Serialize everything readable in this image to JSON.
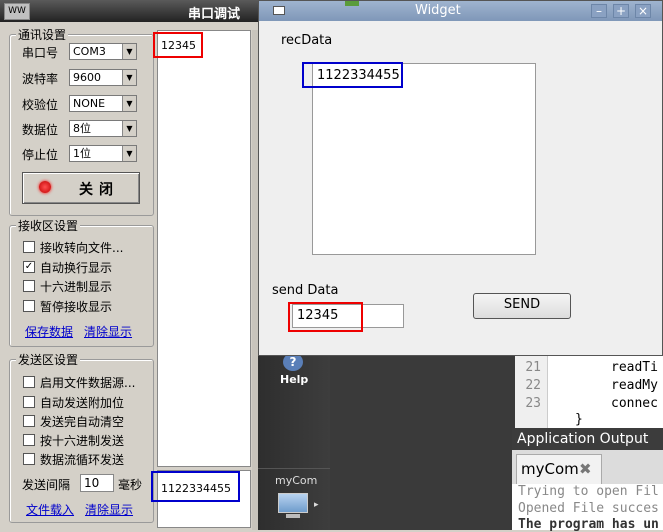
{
  "left_window": {
    "title": "串口调试",
    "app_icon_text": "WW",
    "comm_settings": {
      "title": "通讯设置",
      "rows": [
        {
          "label": "串口号",
          "value": "COM3"
        },
        {
          "label": "波特率",
          "value": "9600"
        },
        {
          "label": "校验位",
          "value": "NONE"
        },
        {
          "label": "数据位",
          "value": "8位"
        },
        {
          "label": "停止位",
          "value": "1位"
        }
      ],
      "close_button": "关闭"
    },
    "receive_settings": {
      "title": "接收区设置",
      "options": [
        {
          "label": "接收转向文件...",
          "checked": false
        },
        {
          "label": "自动换行显示",
          "checked": true
        },
        {
          "label": "十六进制显示",
          "checked": false
        },
        {
          "label": "暂停接收显示",
          "checked": false
        }
      ],
      "save_link": "保存数据",
      "clear_link": "清除显示"
    },
    "send_settings": {
      "title": "发送区设置",
      "options": [
        {
          "label": "启用文件数据源...",
          "checked": false
        },
        {
          "label": "自动发送附加位",
          "checked": false
        },
        {
          "label": "发送完自动清空",
          "checked": false
        },
        {
          "label": "按十六进制发送",
          "checked": false
        },
        {
          "label": "数据流循环发送",
          "checked": false
        }
      ],
      "interval_label": "发送间隔",
      "interval_value": "10",
      "interval_unit": "毫秒",
      "load_file_link": "文件载入",
      "clear_link": "清除显示"
    },
    "receive_text": "12345",
    "send_text": "1122334455"
  },
  "widget": {
    "title": "Widget",
    "rec_label": "recData",
    "rec_text": "1122334455",
    "send_label": "send Data",
    "send_value": "12345",
    "send_button": "SEND"
  },
  "ide": {
    "help_label": "Help",
    "project_label": "myCom",
    "line_numbers": [
      "21",
      "22",
      "23"
    ],
    "code_lines": [
      "readTi",
      "readMy",
      "connec",
      "}"
    ],
    "output_panel_title": "Application Output",
    "output_tab": "myCom",
    "output_lines": [
      "Trying to open Fil",
      "Opened File succes",
      "The program has un"
    ]
  }
}
